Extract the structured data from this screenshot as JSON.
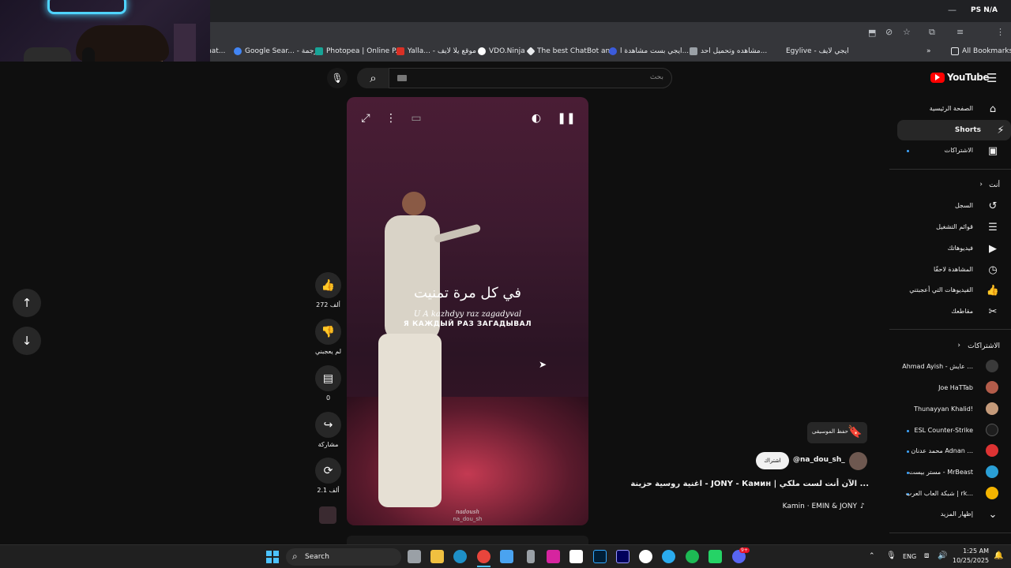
{
  "browser": {
    "window_controls": {
      "minimize": "—",
      "brand": "PS N/A"
    },
    "bookmarks": [
      {
        "label": "hat...",
        "color": "#5f6368"
      },
      {
        "label": "Google Sear... - ترجمة",
        "color": "#4285f4"
      },
      {
        "label": "Photopea | Online P...",
        "color": "#18a497"
      },
      {
        "label": "Yalla... - موقع يلا لايف",
        "color": "#d93025"
      },
      {
        "label": "VDO.Ninja",
        "color": "#ffffff"
      },
      {
        "label": "The best ChatBot an...",
        "color": "#e8eaed"
      },
      {
        "label": "ايجي بست مشاهدة ا...",
        "color": "#3b5bdb"
      },
      {
        "label": "مشاهده وتحميل احد...",
        "color": "#9aa0a6"
      },
      {
        "label": "Egylive - ايجي لايف",
        "color": "#35363a"
      }
    ],
    "all_bookmarks": "All Bookmarks"
  },
  "youtube": {
    "logo": "YouTube",
    "search_placeholder": "بحث",
    "sidebar": {
      "main": [
        {
          "label": "الصفحة الرئيسية",
          "icon": "home-icon",
          "glyph": "⌂"
        },
        {
          "label": "Shorts",
          "icon": "shorts-icon",
          "glyph": "⚡",
          "active": true
        },
        {
          "label": "الاشتراكات",
          "icon": "subscriptions-icon",
          "glyph": "▣"
        }
      ],
      "you_header": "أنت",
      "you": [
        {
          "label": "السجل",
          "icon": "history-icon",
          "glyph": "↺"
        },
        {
          "label": "قوائم التشغيل",
          "icon": "playlists-icon",
          "glyph": "☰"
        },
        {
          "label": "فيديوهاتك",
          "icon": "your-videos-icon",
          "glyph": "▶"
        },
        {
          "label": "المشاهدة لاحقًا",
          "icon": "watch-later-icon",
          "glyph": "◷"
        },
        {
          "label": "الفيديوهات التي أعجبتني",
          "icon": "liked-videos-icon",
          "glyph": "👍"
        },
        {
          "label": "مقاطعك",
          "icon": "clips-icon",
          "glyph": "✂"
        }
      ],
      "subs_header": "الاشتراكات",
      "subscriptions": [
        {
          "label": "Ahmad Ayish - عايش ...",
          "color": "#3a3a3a",
          "dot": false
        },
        {
          "label": "Joe HaTTab",
          "color": "#b35c4a",
          "dot": false
        },
        {
          "label": "Thunayyan Khalid!",
          "color": "#c49a7a",
          "dot": false
        },
        {
          "label": "ESL Counter-Strike",
          "color": "#1e1e1e",
          "dot": true
        },
        {
          "label": "محمد عدنان Adnan ...",
          "color": "#d33",
          "dot": true
        },
        {
          "label": "مستر بيست - MrBeast",
          "color": "#2a9fd6",
          "dot": true
        },
        {
          "label": "شبكة العاب العرب | rk...",
          "color": "#f4b400",
          "dot": true
        }
      ],
      "show_more": "إظهار المزيد"
    },
    "short": {
      "lyric_arabic": "في كل مرة تمنيت",
      "lyric_translit": "U A kazhdyy raz zagadyval",
      "lyric_russian": "Я КАЖДЫЙ РАЗ ЗАГАДЫВАЛ",
      "watermark_1": "nadoush",
      "watermark_2": "na_dou_sh",
      "channel": "@na_dou_sh_",
      "subscribe": "اشتراك",
      "save_music": "حفظ الموسيقى",
      "title": "اغنية روسية حزينة - JONY - Камин | الآن أنت لست ملكي ...",
      "music": "Kamin · EMIN & JONY"
    },
    "actions": {
      "likes": "272 ألف",
      "dislike": "لم يعجبني",
      "comments": "0",
      "share": "مشاركة",
      "remix": "2.1 ألف"
    }
  },
  "taskbar": {
    "search": "Search",
    "lang": "ENG",
    "time": "1:25 AM",
    "date": "10/25/2025",
    "discord_badge": "9+",
    "apps": [
      {
        "name": "task-view-icon",
        "color": "#9aa0a6"
      },
      {
        "name": "file-explorer-icon",
        "color": "#f0c040"
      },
      {
        "name": "edge-icon",
        "color": "#1e90c8"
      },
      {
        "name": "chrome-icon",
        "color": "#e8453c"
      },
      {
        "name": "store-icon",
        "color": "#4aa3f0"
      },
      {
        "name": "usb-icon",
        "color": "#9aa0a6"
      },
      {
        "name": "instagram-icon",
        "color": "#d6249f"
      },
      {
        "name": "capcut-icon",
        "color": "#ffffff"
      },
      {
        "name": "photoshop-icon",
        "color": "#31a8ff"
      },
      {
        "name": "premiere-icon",
        "color": "#9999ff"
      },
      {
        "name": "messenger-icon",
        "color": "#ffffff"
      },
      {
        "name": "telegram-icon",
        "color": "#2aabee"
      },
      {
        "name": "spotify-icon",
        "color": "#1db954"
      },
      {
        "name": "whatsapp-icon",
        "color": "#25d366"
      },
      {
        "name": "discord-icon",
        "color": "#5865f2"
      }
    ]
  }
}
